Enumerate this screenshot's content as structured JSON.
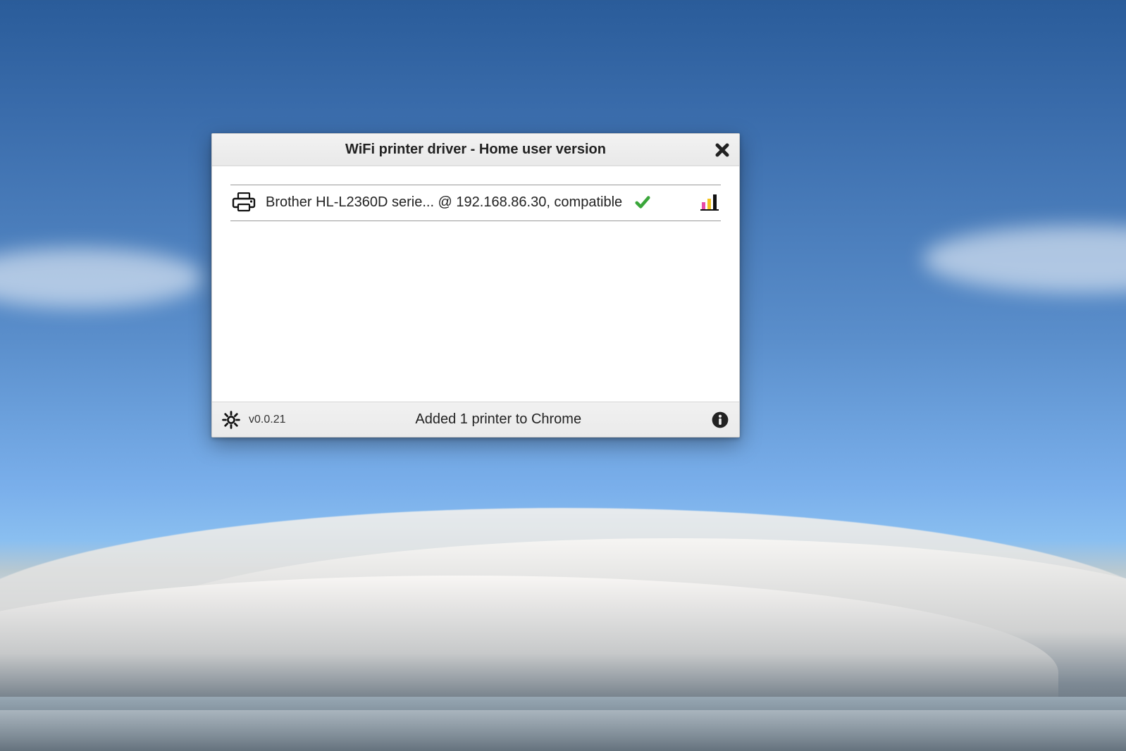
{
  "window": {
    "title": "WiFi printer driver - Home user version"
  },
  "printers": [
    {
      "label": "Brother HL-L2360D serie... @ 192.168.86.30, compatible",
      "status_ok": true
    }
  ],
  "footer": {
    "version": "v0.0.21",
    "status": "Added 1 printer to Chrome"
  },
  "icons": {
    "close": "close-icon",
    "printer": "printer-icon",
    "check": "check-icon",
    "ink": "ink-levels-icon",
    "gear": "gear-icon",
    "info": "info-icon"
  },
  "colors": {
    "ink_magenta": "#e84aa8",
    "ink_yellow": "#f3c321",
    "ink_black": "#111111",
    "check_green": "#3aa63a"
  }
}
